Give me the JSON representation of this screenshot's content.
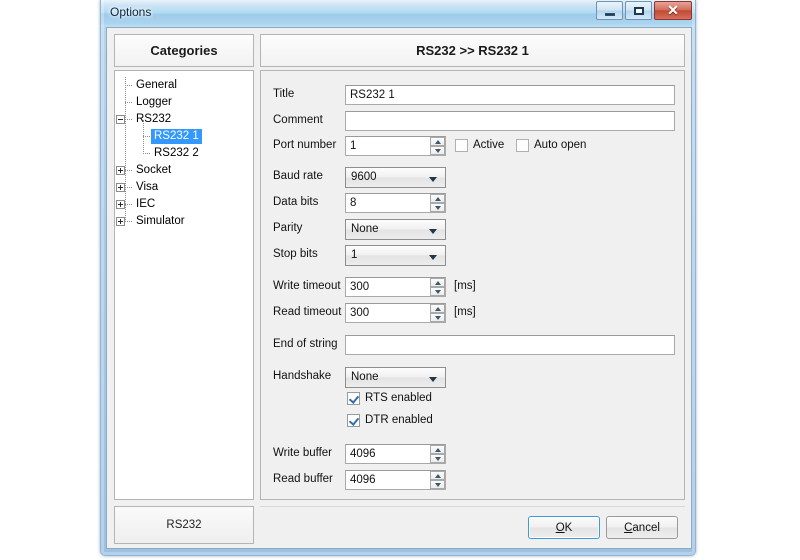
{
  "window": {
    "title": "Options",
    "caption_buttons": [
      {
        "name": "minimize-button",
        "icon": "minimize-icon",
        "label": ""
      },
      {
        "name": "maximize-button",
        "icon": "maximize-icon",
        "label": ""
      },
      {
        "name": "close-button",
        "icon": "close-icon",
        "label": "✕"
      }
    ]
  },
  "headers": {
    "categories": "Categories",
    "page": "RS232 >> RS232 1"
  },
  "tree": {
    "items": [
      {
        "label": "General",
        "level": 1,
        "expander": "none",
        "selected": false
      },
      {
        "label": "Logger",
        "level": 1,
        "expander": "none",
        "selected": false
      },
      {
        "label": "RS232",
        "level": 1,
        "expander": "minus",
        "selected": false
      },
      {
        "label": "RS232 1",
        "level": 2,
        "expander": "none",
        "selected": true
      },
      {
        "label": "RS232 2",
        "level": 2,
        "expander": "none",
        "selected": false
      },
      {
        "label": "Socket",
        "level": 1,
        "expander": "plus",
        "selected": false
      },
      {
        "label": "Visa",
        "level": 1,
        "expander": "plus",
        "selected": false
      },
      {
        "label": "IEC",
        "level": 1,
        "expander": "plus",
        "selected": false
      },
      {
        "label": "Simulator",
        "level": 1,
        "expander": "plus",
        "selected": false
      }
    ]
  },
  "footer_status": "RS232",
  "form": {
    "title": {
      "label": "Title",
      "value": "RS232 1",
      "placeholder": ""
    },
    "comment": {
      "label": "Comment",
      "value": "",
      "placeholder": ""
    },
    "port_number": {
      "label": "Port number",
      "value": "1"
    },
    "active": {
      "label": "Active",
      "checked": false
    },
    "auto_open": {
      "label": "Auto open",
      "checked": false
    },
    "baud_rate": {
      "label": "Baud rate",
      "value": "9600"
    },
    "data_bits": {
      "label": "Data bits",
      "value": "8"
    },
    "parity": {
      "label": "Parity",
      "value": "None"
    },
    "stop_bits": {
      "label": "Stop bits",
      "value": "1"
    },
    "write_timeout": {
      "label": "Write timeout",
      "value": "300",
      "unit": "[ms]"
    },
    "read_timeout": {
      "label": "Read timeout",
      "value": "300",
      "unit": "[ms]"
    },
    "end_of_string": {
      "label": "End of string",
      "value": "",
      "placeholder": ""
    },
    "handshake": {
      "label": "Handshake",
      "value": "None"
    },
    "rts_enabled": {
      "label": "RTS enabled",
      "checked": true
    },
    "dtr_enabled": {
      "label": "DTR enabled",
      "checked": true
    },
    "write_buffer": {
      "label": "Write buffer",
      "value": "4096"
    },
    "read_buffer": {
      "label": "Read buffer",
      "value": "4096"
    }
  },
  "buttons": {
    "ok": {
      "prefix": "",
      "accel": "O",
      "suffix": "K"
    },
    "cancel": {
      "prefix": "",
      "accel": "C",
      "suffix": "ancel"
    }
  },
  "colors": {
    "selection": "#3399ff",
    "frame": "#9cc2e3",
    "focus_border": "#3c9ad6",
    "close_button": "#c04a33"
  }
}
